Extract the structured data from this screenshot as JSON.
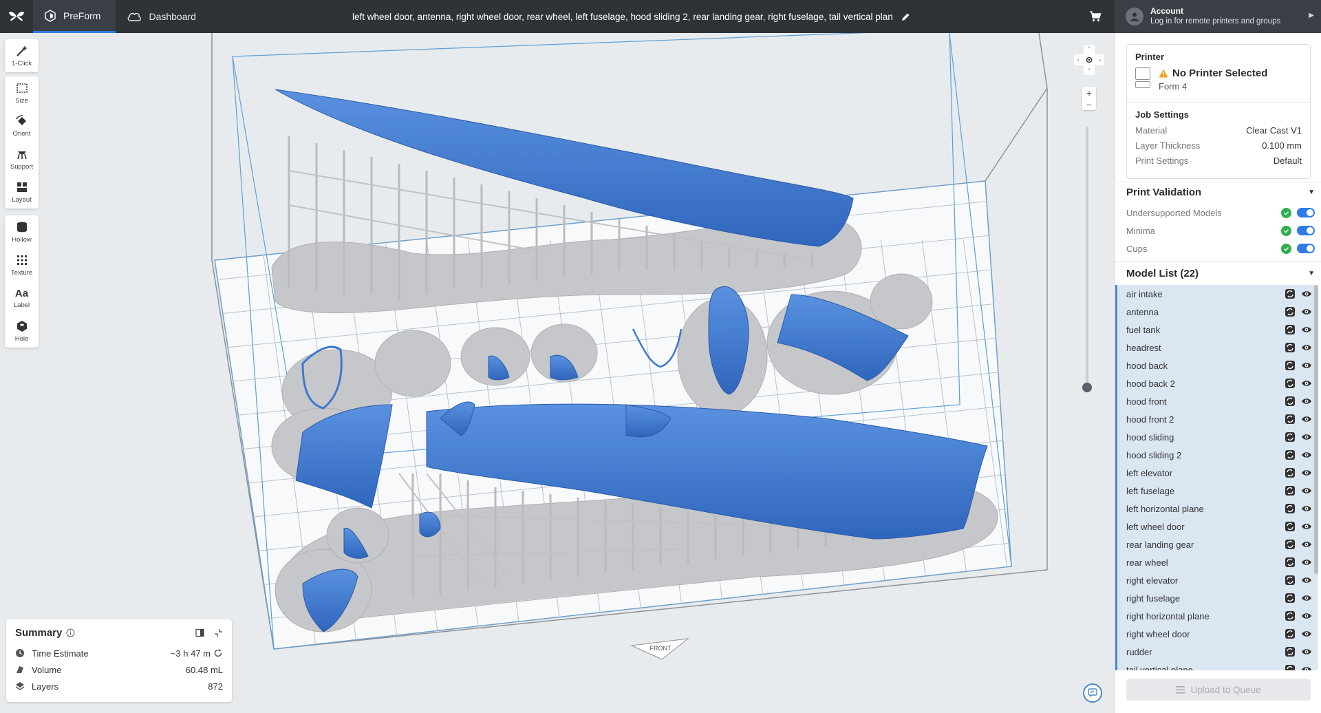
{
  "topbar": {
    "logo_icon": "formlabs-butterfly-icon",
    "preform_tab": "PreForm",
    "dashboard_tab": "Dashboard",
    "job_title": "left wheel door, antenna, right wheel door, rear wheel, left fuselage, hood sliding 2, rear landing gear, right fuselage, tail vertical plan",
    "cart_icon": "cart-icon",
    "account_title": "Account",
    "account_sub": "Log in for remote printers and groups"
  },
  "tools": [
    {
      "label": "1-Click",
      "icon": "magic-wand-icon"
    },
    {
      "label": "Size",
      "icon": "size-icon"
    },
    {
      "label": "Orient",
      "icon": "orient-icon"
    },
    {
      "label": "Support",
      "icon": "support-icon"
    },
    {
      "label": "Layout",
      "icon": "layout-icon"
    },
    {
      "label": "Hollow",
      "icon": "hollow-icon"
    },
    {
      "label": "Texture",
      "icon": "texture-icon"
    },
    {
      "label": "Label",
      "icon_text": "Aa",
      "icon": "label-icon"
    },
    {
      "label": "Hole",
      "icon": "hole-icon"
    }
  ],
  "viewport": {
    "front_label": "FRONT",
    "zoom_in": "+",
    "zoom_out": "−",
    "colors": {
      "model": "#3d78cf",
      "support": "#c9cacd",
      "grid": "#ffffff",
      "bounds": "#5aa0d8"
    }
  },
  "summary": {
    "title": "Summary",
    "rows": [
      {
        "label": "Time Estimate",
        "value": "~3 h 47 m",
        "icon": "clock-icon"
      },
      {
        "label": "Volume",
        "value": "60.48 mL",
        "icon": "volume-icon"
      },
      {
        "label": "Layers",
        "value": "872",
        "icon": "layers-icon"
      }
    ]
  },
  "printer": {
    "section_title": "Printer",
    "name": "No Printer Selected",
    "model": "Form 4",
    "warning_icon": "warning-icon"
  },
  "job_settings": {
    "title": "Job Settings",
    "rows": [
      {
        "label": "Material",
        "value": "Clear Cast V1"
      },
      {
        "label": "Layer Thickness",
        "value": "0.100 mm"
      },
      {
        "label": "Print Settings",
        "value": "Default"
      }
    ]
  },
  "print_validation": {
    "title": "Print Validation",
    "rows": [
      {
        "label": "Undersupported Models"
      },
      {
        "label": "Minima"
      },
      {
        "label": "Cups"
      }
    ]
  },
  "model_list": {
    "title": "Model List (22)",
    "items": [
      "air intake",
      "antenna",
      "fuel tank",
      "headrest",
      "hood back",
      "hood back 2",
      "hood front",
      "hood front 2",
      "hood sliding",
      "hood sliding 2",
      "left elevator",
      "left fuselage",
      "left horizontal plane",
      "left wheel door",
      "rear landing gear",
      "rear wheel",
      "right elevator",
      "right fuselage",
      "right horizontal plane",
      "right wheel door",
      "rudder",
      "tail vertical plane"
    ]
  },
  "upload_button": "Upload to Queue"
}
